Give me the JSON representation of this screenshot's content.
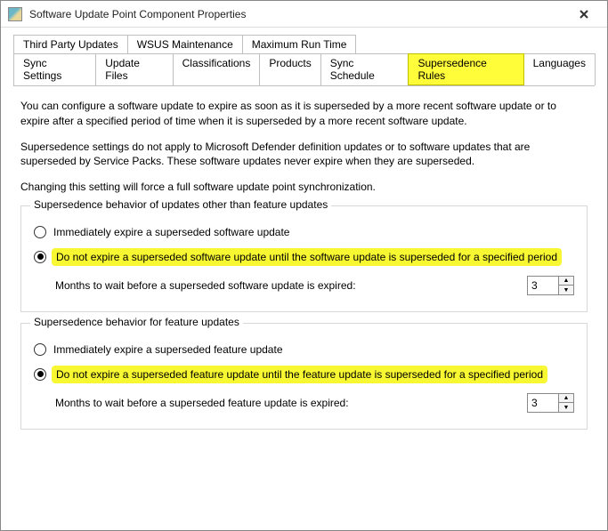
{
  "window": {
    "title": "Software Update Point Component Properties"
  },
  "tabs": {
    "row1": {
      "0": "Third Party Updates",
      "1": "WSUS Maintenance",
      "2": "Maximum Run Time"
    },
    "row2": {
      "0": "Sync Settings",
      "1": "Update Files",
      "2": "Classifications",
      "3": "Products",
      "4": "Sync Schedule",
      "5": "Supersedence Rules",
      "6": "Languages"
    }
  },
  "body": {
    "p1": "You can configure a software update to expire as soon as it is superseded by a more recent software update or to expire after a specified period of time when it is superseded by a more recent software update.",
    "p2": "Supersedence settings do not apply to Microsoft Defender definition updates or to software updates that are superseded by Service Packs. These software updates never expire when they are superseded.",
    "p3": "Changing this setting will force a full software update point synchronization."
  },
  "group1": {
    "legend": "Supersedence behavior of updates other than feature updates",
    "opt1": "Immediately expire a superseded software update",
    "opt2": "Do not expire a superseded software update until the software update is superseded for a specified period",
    "months_label": "Months to wait before a superseded software update is expired:",
    "months_value": "3"
  },
  "group2": {
    "legend": "Supersedence behavior for feature updates",
    "opt1": "Immediately expire a superseded feature update",
    "opt2": "Do not expire a superseded feature update until the feature update is superseded for a specified period",
    "months_label": "Months to wait before a superseded feature update is expired:",
    "months_value": "3"
  }
}
